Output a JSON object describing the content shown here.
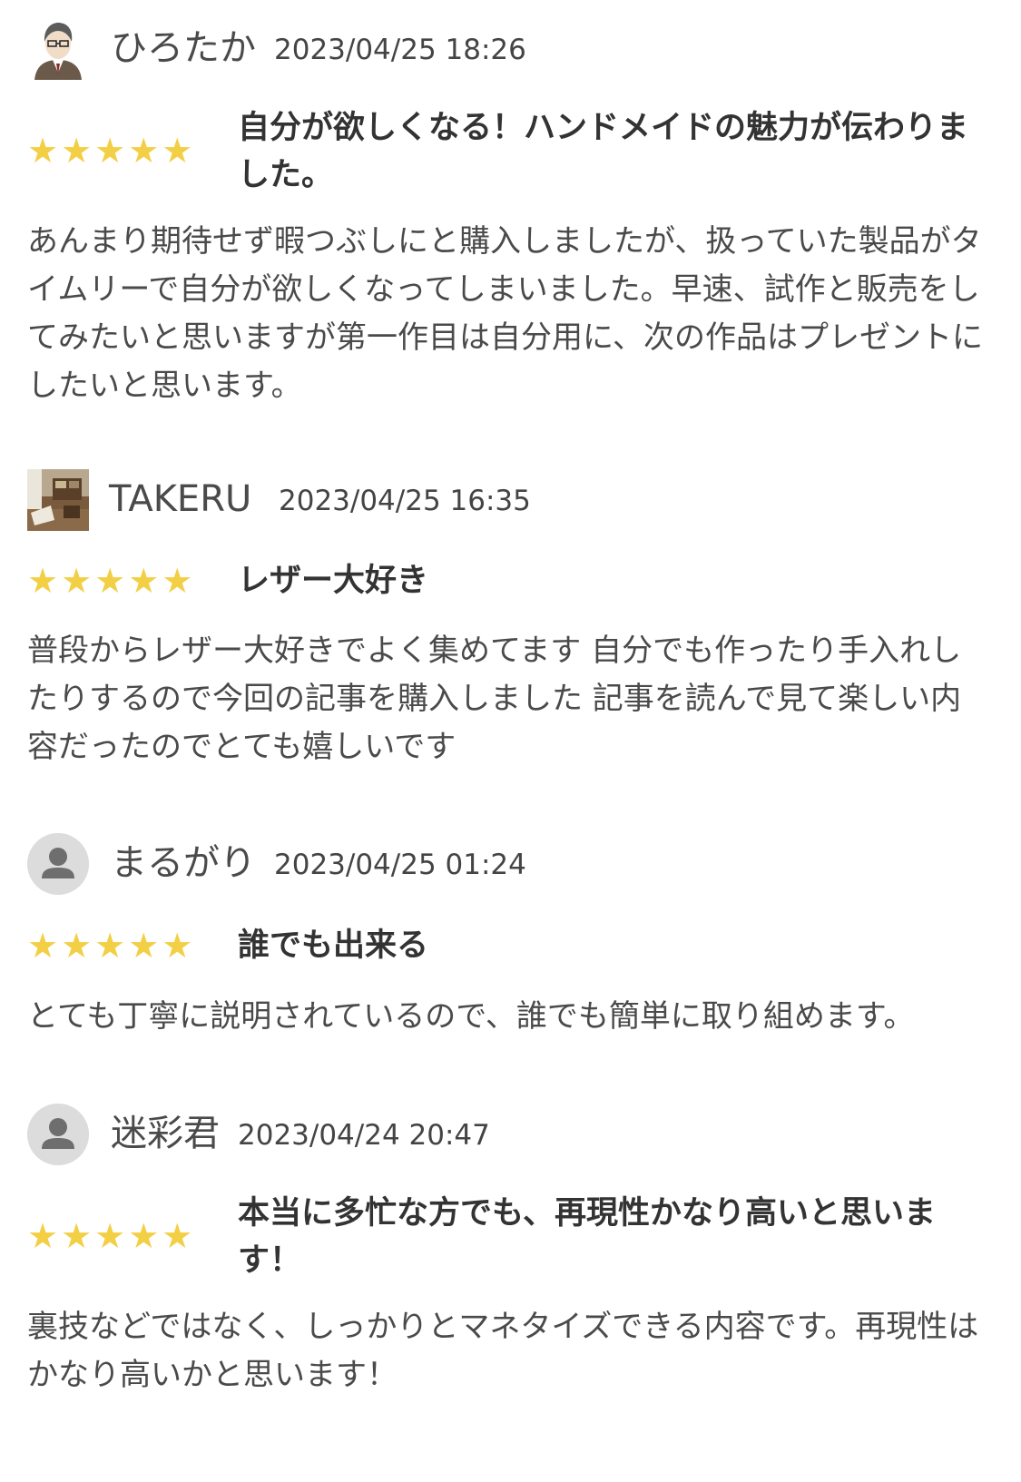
{
  "reviews": [
    {
      "username": "ひろたか",
      "timestamp": "2023/04/25 18:26",
      "rating": 5,
      "avatar": "person-illustration-avatar",
      "title": "自分が欲しくなる！ハンドメイドの魅力が伝わりました。",
      "body": "あんまり期待せず暇つぶしにと購入しましたが、扱っていた製品がタイムリーで自分が欲しくなってしまいました。早速、試作と販売をしてみたいと思いますが第一作目は自分用に、次の作品はプレゼントにしたいと思います。"
    },
    {
      "username": "TAKERU",
      "timestamp": "2023/04/25 16:35",
      "rating": 5,
      "avatar": "room-photo-avatar",
      "title": "レザー大好き",
      "body": "普段からレザー大好きでよく集めてます 自分でも作ったり手入れしたりするので今回の記事を購入しました 記事を読んで見て楽しい内容だったのでとても嬉しいです"
    },
    {
      "username": "まるがり",
      "timestamp": "2023/04/25 01:24",
      "rating": 5,
      "avatar": "default-user-icon",
      "title": "誰でも出来る",
      "body": "とても丁寧に説明されているので、誰でも簡単に取り組めます。"
    },
    {
      "username": "迷彩君",
      "timestamp": "2023/04/24 20:47",
      "rating": 5,
      "avatar": "default-user-icon",
      "title": "本当に多忙な方でも、再現性かなり高いと思います！",
      "body": "裏技などではなく、しっかりとマネタイズできる内容です。再現性はかなり高いかと思います！"
    }
  ],
  "stars_glyph": "★★★★★",
  "colors": {
    "star": "#f3cf45",
    "text": "#333333",
    "muted": "#4a4a4a",
    "avatar_bg": "#dcdcdc"
  }
}
